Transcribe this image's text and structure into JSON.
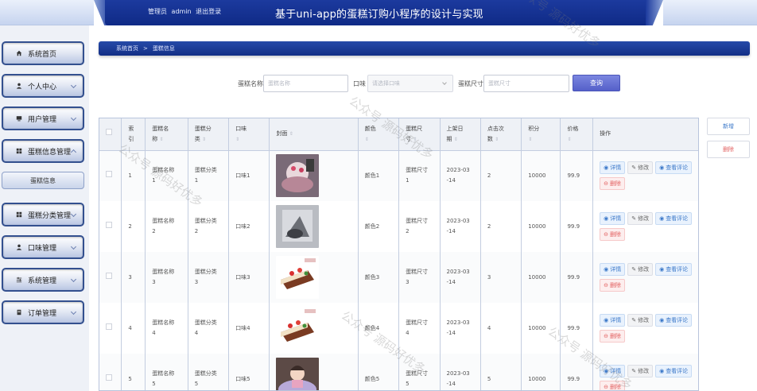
{
  "header": {
    "role_label": "管理员",
    "username": "admin",
    "logout_label": "退出登录",
    "app_title": "基于uni-app的蛋糕订购小程序的设计与实现"
  },
  "sidebar": {
    "items": [
      {
        "label": "系统首页",
        "icon": "home-icon"
      },
      {
        "label": "个人中心",
        "icon": "user-icon"
      },
      {
        "label": "用户管理",
        "icon": "monitor-icon"
      },
      {
        "label": "蛋糕信息管理",
        "icon": "grid-icon"
      },
      {
        "label": "蛋糕分类管理",
        "icon": "grid-icon"
      },
      {
        "label": "口味管理",
        "icon": "user-icon"
      },
      {
        "label": "系统管理",
        "icon": "settings-icon"
      },
      {
        "label": "订单管理",
        "icon": "order-icon"
      }
    ],
    "submenu_label": "蛋糕信息"
  },
  "breadcrumb": {
    "home": "系统首页",
    "current": "蛋糕信息"
  },
  "search": {
    "name_label": "蛋糕名称",
    "name_placeholder": "蛋糕名称",
    "flavor_label": "口味",
    "flavor_placeholder": "请选择口味",
    "size_label": "蛋糕尺寸",
    "size_placeholder": "蛋糕尺寸",
    "query_label": "查询"
  },
  "actions": {
    "add_label": "新增",
    "delete_label": "删除"
  },
  "table": {
    "headers": {
      "index": [
        "索",
        "引"
      ],
      "name": [
        "蛋糕名",
        "称"
      ],
      "category": [
        "蛋糕分",
        "类"
      ],
      "flavor": "口味",
      "cover": "封面",
      "color": "颜色",
      "size": [
        "蛋糕尺",
        "寸"
      ],
      "date": [
        "上架日",
        "期"
      ],
      "clicks": [
        "点击次",
        "数"
      ],
      "points": "积分",
      "price": "价格",
      "ops": "操作"
    },
    "sort_glyph": "⇕",
    "op_labels": {
      "detail": "详情",
      "edit": "修改",
      "comments": "查看评论",
      "delete": "删除"
    },
    "rows": [
      {
        "index": "1",
        "name": [
          "蛋糕名称",
          "1"
        ],
        "category": [
          "蛋糕分类",
          "1"
        ],
        "flavor": "口味1",
        "color": "颜色1",
        "size": [
          "蛋糕尺寸",
          "1"
        ],
        "date": [
          "2023-03",
          "-14"
        ],
        "clicks": "2",
        "points": "10000",
        "price": "99.9"
      },
      {
        "index": "2",
        "name": [
          "蛋糕名称",
          "2"
        ],
        "category": [
          "蛋糕分类",
          "2"
        ],
        "flavor": "口味2",
        "color": "颜色2",
        "size": [
          "蛋糕尺寸",
          "2"
        ],
        "date": [
          "2023-03",
          "-14"
        ],
        "clicks": "2",
        "points": "10000",
        "price": "99.9"
      },
      {
        "index": "3",
        "name": [
          "蛋糕名称",
          "3"
        ],
        "category": [
          "蛋糕分类",
          "3"
        ],
        "flavor": "口味3",
        "color": "颜色3",
        "size": [
          "蛋糕尺寸",
          "3"
        ],
        "date": [
          "2023-03",
          "-14"
        ],
        "clicks": "3",
        "points": "10000",
        "price": "99.9"
      },
      {
        "index": "4",
        "name": [
          "蛋糕名称",
          "4"
        ],
        "category": [
          "蛋糕分类",
          "4"
        ],
        "flavor": "口味4",
        "color": "颜色4",
        "size": [
          "蛋糕尺寸",
          "4"
        ],
        "date": [
          "2023-03",
          "-14"
        ],
        "clicks": "4",
        "points": "10000",
        "price": "99.9"
      },
      {
        "index": "5",
        "name": [
          "蛋糕名称",
          "5"
        ],
        "category": [
          "蛋糕分类",
          "5"
        ],
        "flavor": "口味5",
        "color": "颜色5",
        "size": [
          "蛋糕尺寸",
          "5"
        ],
        "date": [
          "2023-03",
          "-14"
        ],
        "clicks": "5",
        "points": "10000",
        "price": "99.9"
      }
    ]
  },
  "watermark": "公众号 源码好优多",
  "colors": {
    "header": "#132f86",
    "accent": "#5560c9",
    "link": "#3b78c9",
    "danger": "#e26060"
  }
}
